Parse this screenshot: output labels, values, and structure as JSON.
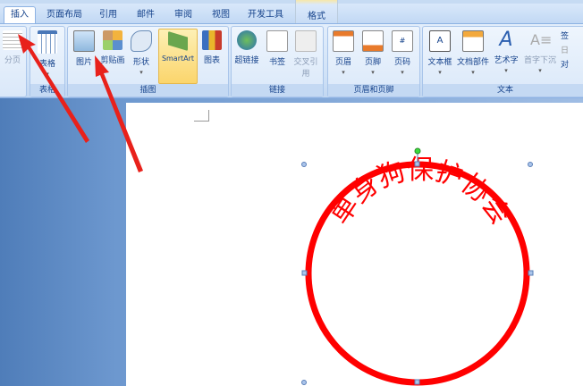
{
  "tabs": [
    "插入",
    "页面布局",
    "引用",
    "邮件",
    "审阅",
    "视图",
    "开发工具",
    "格式"
  ],
  "ribbon": {
    "groups": [
      {
        "label": "表格",
        "buttons": [
          {
            "label": "表格"
          }
        ]
      },
      {
        "label": "插图",
        "buttons": [
          {
            "label": "图片"
          },
          {
            "label": "剪贴画"
          },
          {
            "label": "形状"
          },
          {
            "label": "SmartArt"
          },
          {
            "label": "图表"
          }
        ]
      },
      {
        "label": "链接",
        "buttons": [
          {
            "label": "超链接"
          },
          {
            "label": "书签"
          },
          {
            "label": "交叉引用"
          }
        ]
      },
      {
        "label": "页眉和页脚",
        "buttons": [
          {
            "label": "页眉"
          },
          {
            "label": "页脚"
          },
          {
            "label": "页码"
          }
        ]
      },
      {
        "label": "文本",
        "buttons": [
          {
            "label": "文本框"
          },
          {
            "label": "文档部件"
          },
          {
            "label": "艺术字"
          },
          {
            "label": "首字下沉"
          }
        ]
      }
    ],
    "page_break": "分页",
    "small_buttons": [
      "签",
      "日",
      "对"
    ]
  },
  "stamp": {
    "text": "单身狗保护协会",
    "color": "#ff0000"
  }
}
